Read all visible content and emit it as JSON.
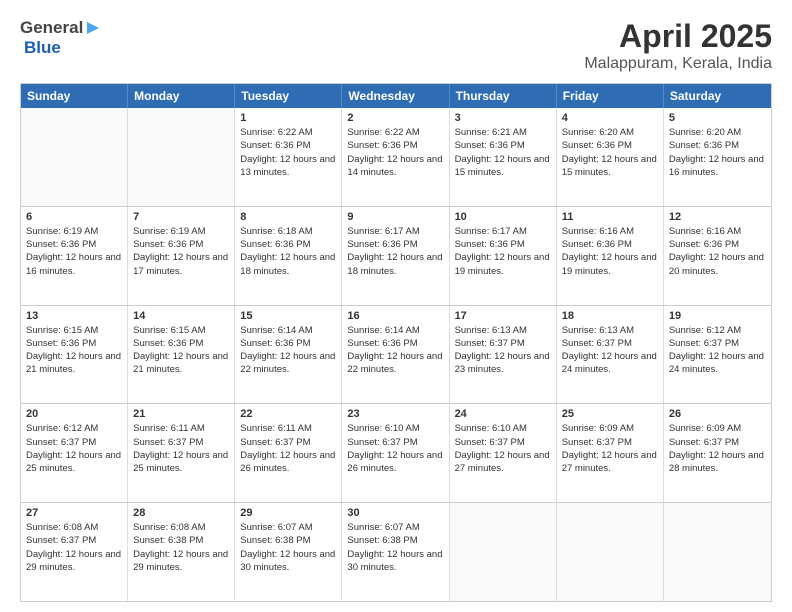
{
  "header": {
    "logo_general": "General",
    "logo_blue": "Blue",
    "month_title": "April 2025",
    "location": "Malappuram, Kerala, India"
  },
  "weekdays": [
    "Sunday",
    "Monday",
    "Tuesday",
    "Wednesday",
    "Thursday",
    "Friday",
    "Saturday"
  ],
  "weeks": [
    [
      {
        "day": "",
        "sunrise": "",
        "sunset": "",
        "daylight": ""
      },
      {
        "day": "",
        "sunrise": "",
        "sunset": "",
        "daylight": ""
      },
      {
        "day": "1",
        "sunrise": "Sunrise: 6:22 AM",
        "sunset": "Sunset: 6:36 PM",
        "daylight": "Daylight: 12 hours and 13 minutes."
      },
      {
        "day": "2",
        "sunrise": "Sunrise: 6:22 AM",
        "sunset": "Sunset: 6:36 PM",
        "daylight": "Daylight: 12 hours and 14 minutes."
      },
      {
        "day": "3",
        "sunrise": "Sunrise: 6:21 AM",
        "sunset": "Sunset: 6:36 PM",
        "daylight": "Daylight: 12 hours and 15 minutes."
      },
      {
        "day": "4",
        "sunrise": "Sunrise: 6:20 AM",
        "sunset": "Sunset: 6:36 PM",
        "daylight": "Daylight: 12 hours and 15 minutes."
      },
      {
        "day": "5",
        "sunrise": "Sunrise: 6:20 AM",
        "sunset": "Sunset: 6:36 PM",
        "daylight": "Daylight: 12 hours and 16 minutes."
      }
    ],
    [
      {
        "day": "6",
        "sunrise": "Sunrise: 6:19 AM",
        "sunset": "Sunset: 6:36 PM",
        "daylight": "Daylight: 12 hours and 16 minutes."
      },
      {
        "day": "7",
        "sunrise": "Sunrise: 6:19 AM",
        "sunset": "Sunset: 6:36 PM",
        "daylight": "Daylight: 12 hours and 17 minutes."
      },
      {
        "day": "8",
        "sunrise": "Sunrise: 6:18 AM",
        "sunset": "Sunset: 6:36 PM",
        "daylight": "Daylight: 12 hours and 18 minutes."
      },
      {
        "day": "9",
        "sunrise": "Sunrise: 6:17 AM",
        "sunset": "Sunset: 6:36 PM",
        "daylight": "Daylight: 12 hours and 18 minutes."
      },
      {
        "day": "10",
        "sunrise": "Sunrise: 6:17 AM",
        "sunset": "Sunset: 6:36 PM",
        "daylight": "Daylight: 12 hours and 19 minutes."
      },
      {
        "day": "11",
        "sunrise": "Sunrise: 6:16 AM",
        "sunset": "Sunset: 6:36 PM",
        "daylight": "Daylight: 12 hours and 19 minutes."
      },
      {
        "day": "12",
        "sunrise": "Sunrise: 6:16 AM",
        "sunset": "Sunset: 6:36 PM",
        "daylight": "Daylight: 12 hours and 20 minutes."
      }
    ],
    [
      {
        "day": "13",
        "sunrise": "Sunrise: 6:15 AM",
        "sunset": "Sunset: 6:36 PM",
        "daylight": "Daylight: 12 hours and 21 minutes."
      },
      {
        "day": "14",
        "sunrise": "Sunrise: 6:15 AM",
        "sunset": "Sunset: 6:36 PM",
        "daylight": "Daylight: 12 hours and 21 minutes."
      },
      {
        "day": "15",
        "sunrise": "Sunrise: 6:14 AM",
        "sunset": "Sunset: 6:36 PM",
        "daylight": "Daylight: 12 hours and 22 minutes."
      },
      {
        "day": "16",
        "sunrise": "Sunrise: 6:14 AM",
        "sunset": "Sunset: 6:36 PM",
        "daylight": "Daylight: 12 hours and 22 minutes."
      },
      {
        "day": "17",
        "sunrise": "Sunrise: 6:13 AM",
        "sunset": "Sunset: 6:37 PM",
        "daylight": "Daylight: 12 hours and 23 minutes."
      },
      {
        "day": "18",
        "sunrise": "Sunrise: 6:13 AM",
        "sunset": "Sunset: 6:37 PM",
        "daylight": "Daylight: 12 hours and 24 minutes."
      },
      {
        "day": "19",
        "sunrise": "Sunrise: 6:12 AM",
        "sunset": "Sunset: 6:37 PM",
        "daylight": "Daylight: 12 hours and 24 minutes."
      }
    ],
    [
      {
        "day": "20",
        "sunrise": "Sunrise: 6:12 AM",
        "sunset": "Sunset: 6:37 PM",
        "daylight": "Daylight: 12 hours and 25 minutes."
      },
      {
        "day": "21",
        "sunrise": "Sunrise: 6:11 AM",
        "sunset": "Sunset: 6:37 PM",
        "daylight": "Daylight: 12 hours and 25 minutes."
      },
      {
        "day": "22",
        "sunrise": "Sunrise: 6:11 AM",
        "sunset": "Sunset: 6:37 PM",
        "daylight": "Daylight: 12 hours and 26 minutes."
      },
      {
        "day": "23",
        "sunrise": "Sunrise: 6:10 AM",
        "sunset": "Sunset: 6:37 PM",
        "daylight": "Daylight: 12 hours and 26 minutes."
      },
      {
        "day": "24",
        "sunrise": "Sunrise: 6:10 AM",
        "sunset": "Sunset: 6:37 PM",
        "daylight": "Daylight: 12 hours and 27 minutes."
      },
      {
        "day": "25",
        "sunrise": "Sunrise: 6:09 AM",
        "sunset": "Sunset: 6:37 PM",
        "daylight": "Daylight: 12 hours and 27 minutes."
      },
      {
        "day": "26",
        "sunrise": "Sunrise: 6:09 AM",
        "sunset": "Sunset: 6:37 PM",
        "daylight": "Daylight: 12 hours and 28 minutes."
      }
    ],
    [
      {
        "day": "27",
        "sunrise": "Sunrise: 6:08 AM",
        "sunset": "Sunset: 6:37 PM",
        "daylight": "Daylight: 12 hours and 29 minutes."
      },
      {
        "day": "28",
        "sunrise": "Sunrise: 6:08 AM",
        "sunset": "Sunset: 6:38 PM",
        "daylight": "Daylight: 12 hours and 29 minutes."
      },
      {
        "day": "29",
        "sunrise": "Sunrise: 6:07 AM",
        "sunset": "Sunset: 6:38 PM",
        "daylight": "Daylight: 12 hours and 30 minutes."
      },
      {
        "day": "30",
        "sunrise": "Sunrise: 6:07 AM",
        "sunset": "Sunset: 6:38 PM",
        "daylight": "Daylight: 12 hours and 30 minutes."
      },
      {
        "day": "",
        "sunrise": "",
        "sunset": "",
        "daylight": ""
      },
      {
        "day": "",
        "sunrise": "",
        "sunset": "",
        "daylight": ""
      },
      {
        "day": "",
        "sunrise": "",
        "sunset": "",
        "daylight": ""
      }
    ]
  ]
}
